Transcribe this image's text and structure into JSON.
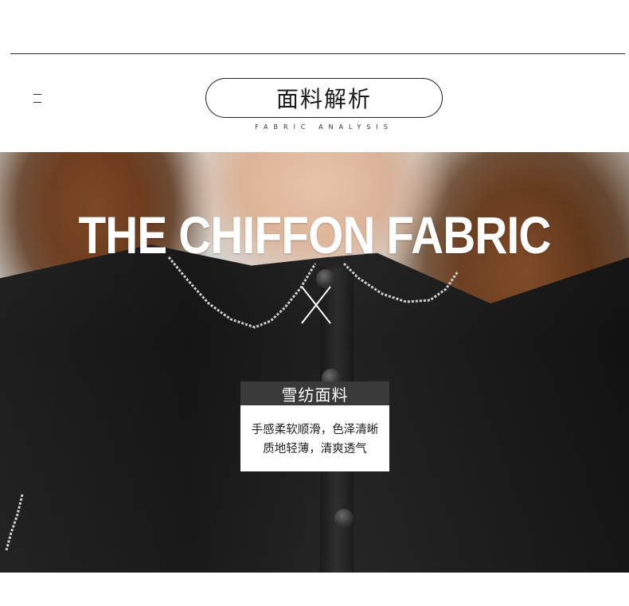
{
  "header": {
    "title": "面料解析",
    "subtitle": "FABRIC ANALYSIS"
  },
  "hero": {
    "headline": "THE CHIFFON FABRIC"
  },
  "fabric_card": {
    "title": "雪纺面料",
    "lines": [
      "手感柔软顺滑，色泽清晰",
      "质地轻薄，清爽透气"
    ]
  },
  "colors": {
    "card_header": "#3a3a3a",
    "shirt": "#1a1a1a",
    "hair": "#6f3e1d"
  }
}
